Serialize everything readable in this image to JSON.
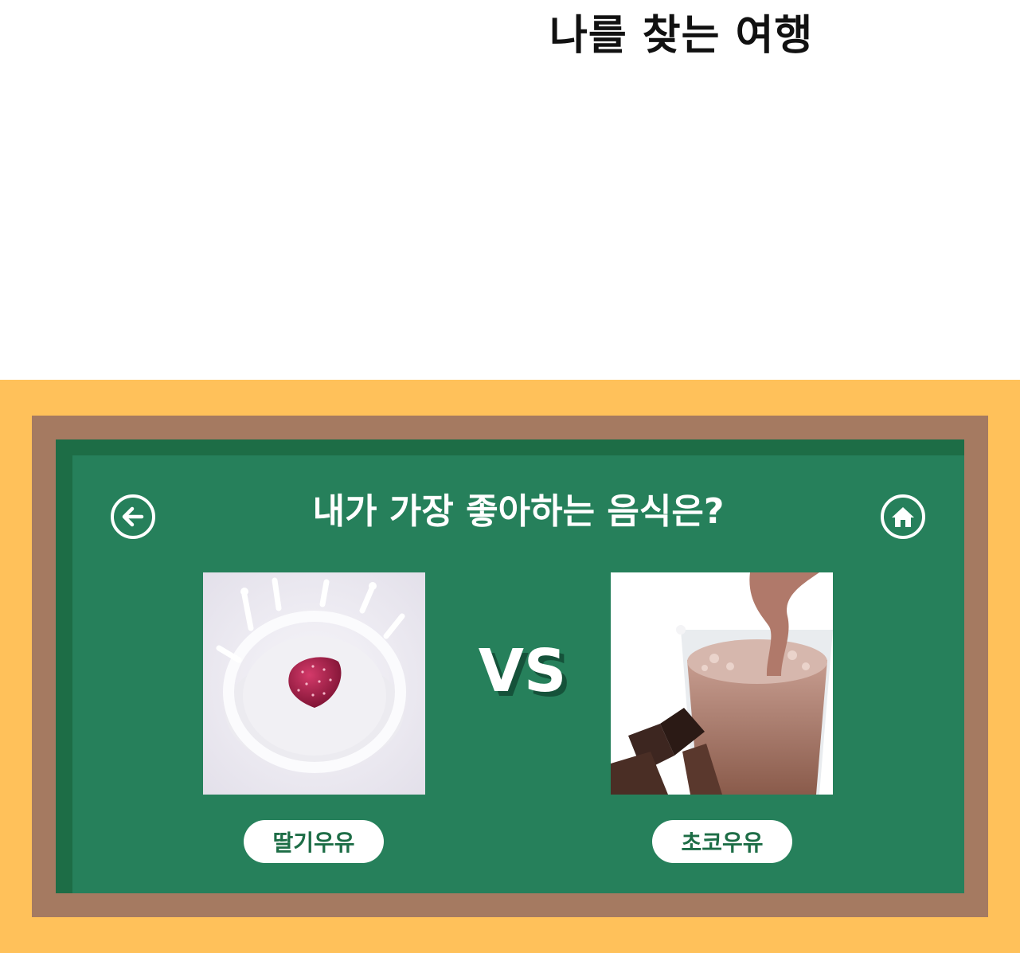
{
  "app": {
    "title": "나를 찾는 여행"
  },
  "quiz": {
    "question": "내가 가장 좋아하는 음식은?",
    "vs_label": "VS",
    "options": [
      {
        "label": "딸기우유",
        "image": "strawberry-in-milk-splash"
      },
      {
        "label": "초코우유",
        "image": "chocolate-milk-glass"
      }
    ]
  },
  "icons": {
    "back": "arrow-left-circle-icon",
    "home": "home-circle-icon"
  },
  "colors": {
    "outer_frame": "#ffc15a",
    "wood_frame": "#a57a61",
    "board": "#26805b",
    "board_shadow": "#1d6d46",
    "text": "#ffffff",
    "button_text": "#1d6d46"
  }
}
